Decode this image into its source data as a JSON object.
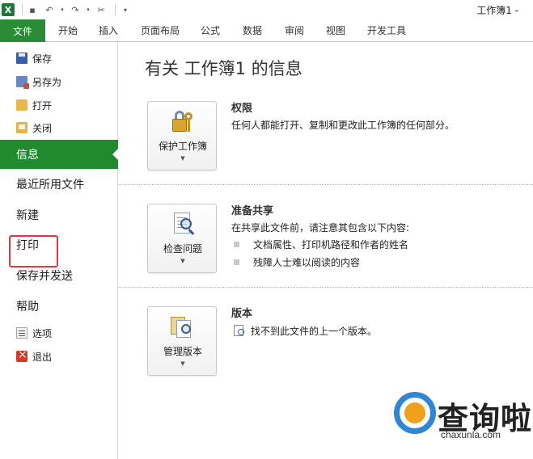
{
  "window": {
    "title": "工作簿1 -"
  },
  "ribbon": {
    "tabs": [
      "文件",
      "开始",
      "插入",
      "页面布局",
      "公式",
      "数据",
      "审阅",
      "视图",
      "开发工具"
    ]
  },
  "nav": {
    "save": "保存",
    "save_as": "另存为",
    "open": "打开",
    "close": "关闭",
    "info": "信息",
    "recent": "最近所用文件",
    "new": "新建",
    "print": "打印",
    "save_send": "保存并发送",
    "help": "帮助",
    "options": "选项",
    "exit": "退出"
  },
  "main": {
    "title": "有关 工作簿1 的信息",
    "permissions": {
      "button": "保护工作簿",
      "title": "权限",
      "desc": "任何人都能打开、复制和更改此工作簿的任何部分。"
    },
    "prepare": {
      "button": "检查问题",
      "title": "准备共享",
      "desc": "在共享此文件前，请注意其包含以下内容:",
      "bullets": [
        "文档属性、打印机路径和作者的姓名",
        "残障人士难以阅读的内容"
      ]
    },
    "versions": {
      "button": "管理版本",
      "title": "版本",
      "desc": "找不到此文件的上一个版本。"
    }
  },
  "watermark": {
    "brand": "查询啦",
    "url": "chaxunla.com"
  },
  "colors": {
    "file_tab": "#2a8a36",
    "active_nav": "#1f8b2c",
    "highlight_border": "#e0393f"
  }
}
